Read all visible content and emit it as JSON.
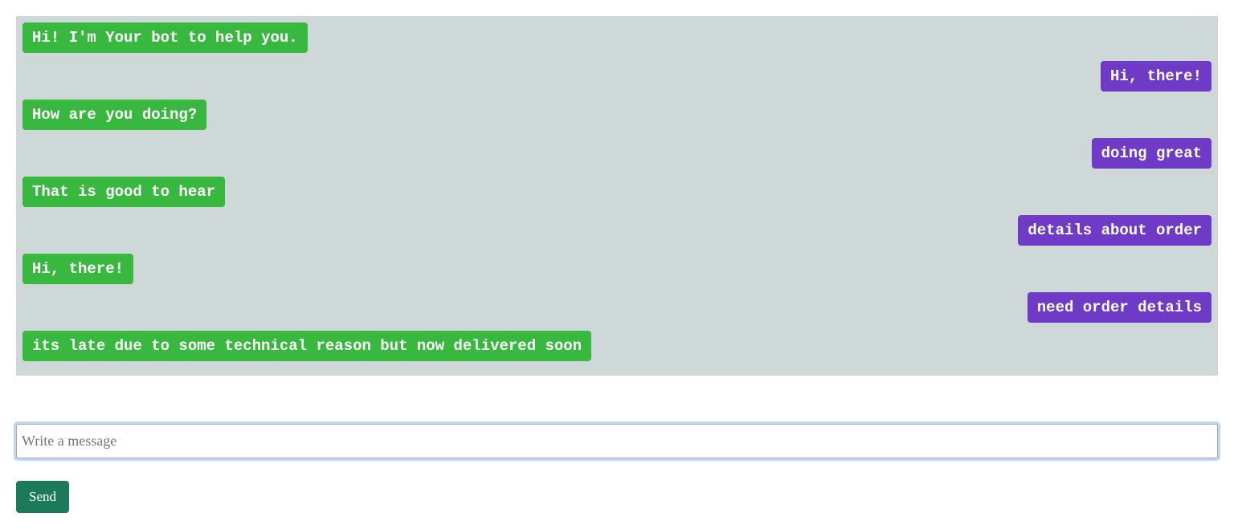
{
  "messages": [
    {
      "role": "bot",
      "text": "Hi! I'm Your bot to help you."
    },
    {
      "role": "user",
      "text": "Hi, there!"
    },
    {
      "role": "bot",
      "text": "How are you doing?"
    },
    {
      "role": "user",
      "text": "doing great"
    },
    {
      "role": "bot",
      "text": "That is good to hear"
    },
    {
      "role": "user",
      "text": "details about order"
    },
    {
      "role": "bot",
      "text": "Hi, there!"
    },
    {
      "role": "user",
      "text": "need order details"
    },
    {
      "role": "bot",
      "text": "its late due to some technical reason but now delivered soon"
    }
  ],
  "input": {
    "placeholder": "Write a message",
    "value": ""
  },
  "buttons": {
    "send": "Send"
  }
}
